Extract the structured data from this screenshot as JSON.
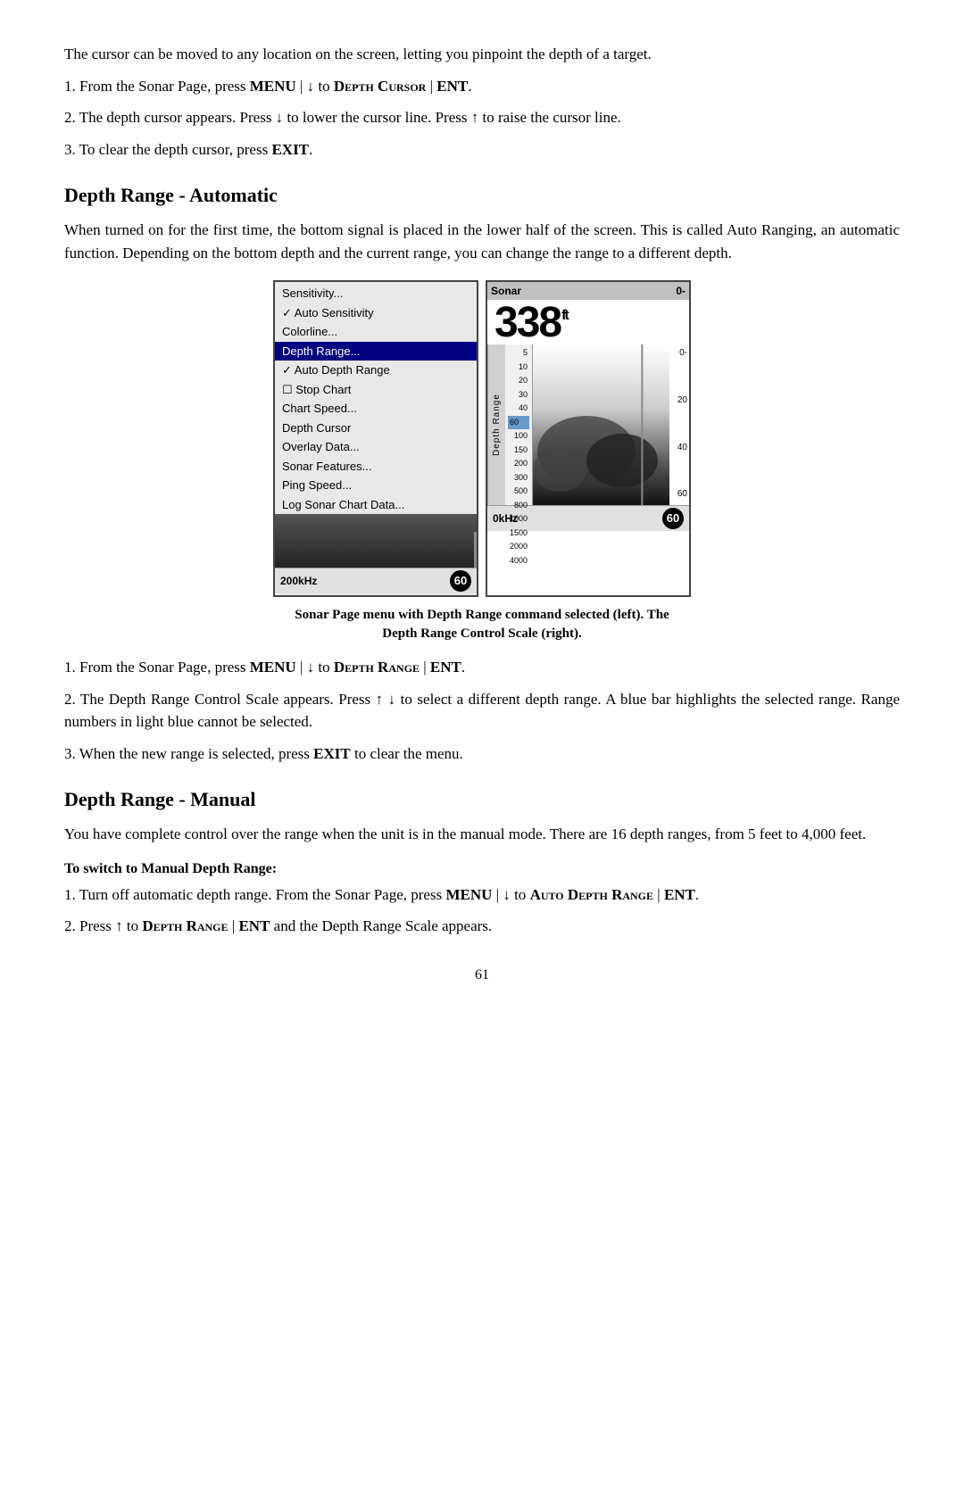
{
  "intro": {
    "p1": "The cursor can be moved to any location on the screen, letting you pinpoint the depth of a target.",
    "step1": "1. From the Sonar Page, press ",
    "step1_bold1": "MENU",
    "step1_sep1": " | ↓ to ",
    "step1_sc1": "Depth Cursor",
    "step1_sep2": " | ",
    "step1_bold2": "ENT",
    "step1_end": ".",
    "step2": "2. The depth cursor appears. Press ↓ to lower the cursor line. Press ↑ to raise the cursor line.",
    "step3": "3. To clear the depth cursor, press ",
    "step3_bold": "EXIT",
    "step3_end": "."
  },
  "section1": {
    "heading": "Depth Range - Automatic",
    "p1": "When turned on for the first time, the bottom signal is placed in the lower half of the screen. This is called Auto Ranging, an automatic function. Depending on the bottom depth and the current range, you can change the range to a different depth.",
    "menu_items": [
      {
        "label": "Sensitivity...",
        "type": "normal"
      },
      {
        "label": "✗ Auto Sensitivity",
        "type": "check"
      },
      {
        "label": "Colorline...",
        "type": "normal"
      },
      {
        "label": "Depth Range...",
        "type": "highlighted"
      },
      {
        "label": "✗ Auto Depth Range",
        "type": "check"
      },
      {
        "label": "☐ Stop Chart",
        "type": "check"
      },
      {
        "label": "Chart Speed...",
        "type": "normal"
      },
      {
        "label": "Depth Cursor",
        "type": "normal"
      },
      {
        "label": "Overlay Data...",
        "type": "normal"
      },
      {
        "label": "Sonar Features...",
        "type": "normal"
      },
      {
        "label": "Ping Speed...",
        "type": "normal"
      },
      {
        "label": "Log Sonar Chart Data...",
        "type": "normal"
      }
    ],
    "sonar_depth": "338",
    "sonar_unit": "ft",
    "sonar_label": "Sonar",
    "depth_scale_right": [
      "0-",
      "",
      "20",
      "",
      "40",
      "",
      "60"
    ],
    "depth_scale_left": [
      "5",
      "10",
      "20",
      "30",
      "40",
      "60",
      "100",
      "150",
      "200",
      "300",
      "500",
      "800",
      "1000",
      "1500",
      "2000",
      "4000"
    ],
    "freq_left": "200kHz",
    "freq_right": "0kHz",
    "badge": "60",
    "depth_range_label": "Depth Range",
    "caption_line1": "Sonar Page menu with Depth Range command selected (left). The",
    "caption_line2": "Depth Range Control Scale (right).",
    "step1": "1. From the Sonar Page, press ",
    "step1_bold1": "MENU",
    "step1_sep1": " | ↓ to ",
    "step1_sc1": "Depth Range",
    "step1_sep2": " | ",
    "step1_bold2": "ENT",
    "step1_end": ".",
    "step2_pre": "2. The Depth Range Control Scale appears. Press ↑ ↓ to select a different depth range. A blue bar highlights the selected range. Range numbers in light blue cannot be selected.",
    "step3": "3. When the new range is selected, press ",
    "step3_bold": "EXIT",
    "step3_end": " to clear the menu."
  },
  "section2": {
    "heading": "Depth Range - Manual",
    "p1": "You have complete control over the range when the unit is in the manual mode. There are 16 depth ranges, from 5 feet to 4,000 feet.",
    "sub_heading": "To switch to Manual Depth Range:",
    "step1_pre": "1. Turn off automatic depth range. From the Sonar Page, press ",
    "step1_bold1": "MENU",
    "step1_sep": " | ↓",
    "step1_post": " to ",
    "step1_sc": "Auto Depth Range",
    "step1_sep2": " | ",
    "step1_bold2": "ENT",
    "step1_end": ".",
    "step2_pre": "2. Press ↑ to ",
    "step2_sc1": "Depth Range",
    "step2_sep": " | ",
    "step2_bold": "ENT",
    "step2_end": " and the Depth Range Scale appears."
  },
  "page_number": "61"
}
